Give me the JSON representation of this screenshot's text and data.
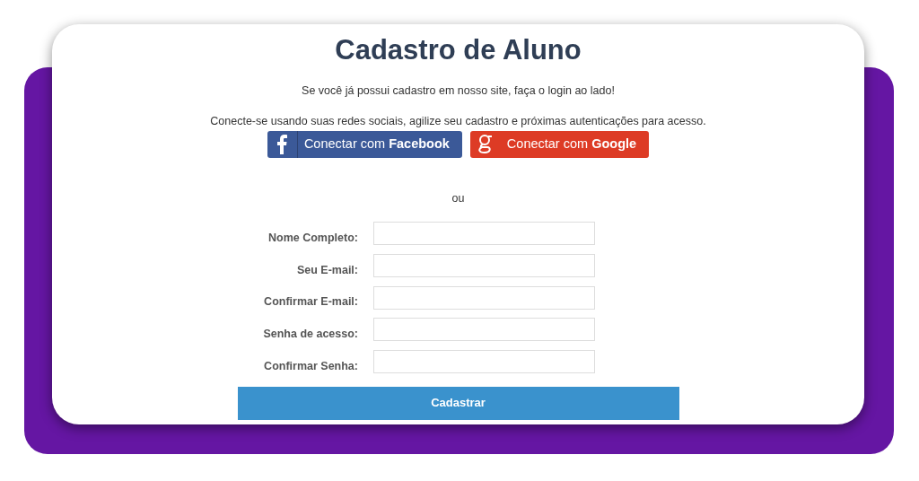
{
  "title": "Cadastro de Aluno",
  "login_hint": "Se você já possui cadastro em nosso site, faça o login ao lado!",
  "social_hint": "Conecte-se usando suas redes sociais, agilize seu cadastro e próximas autenticações para acesso.",
  "social_buttons": [
    {
      "kind": "facebook",
      "label": "Conectar com **Facebook**"
    },
    {
      "kind": "google",
      "label": "Conectar com **Google**"
    }
  ],
  "separator": "ou",
  "fields": [
    {
      "label": "Nome Completo:"
    },
    {
      "label": "Seu E-mail:"
    },
    {
      "label": "Confirmar E-mail:"
    },
    {
      "label": "Senha de acesso:"
    },
    {
      "label": "Confirmar Senha:"
    }
  ],
  "submit": "Cadastrar"
}
